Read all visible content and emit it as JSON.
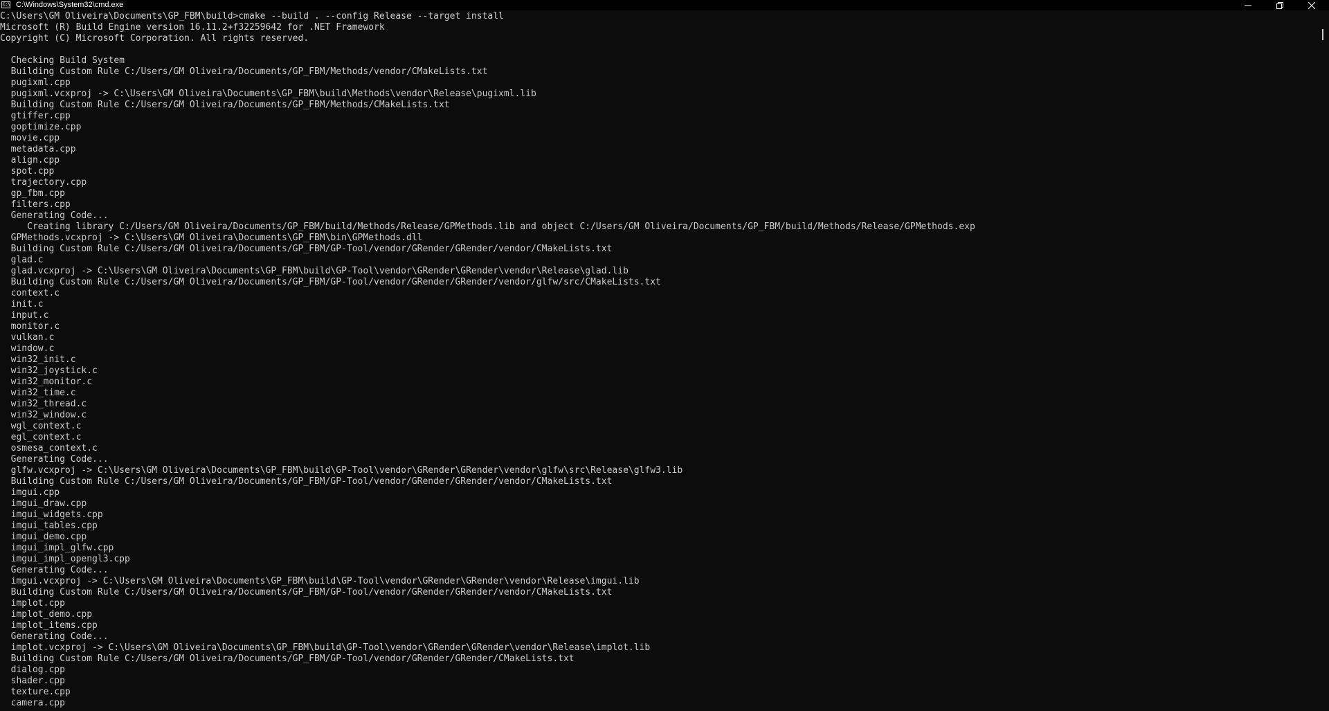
{
  "window": {
    "title": "C:\\Windows\\System32\\cmd.exe",
    "icon": "cmd-icon",
    "icon_text": "C:\\",
    "controls": {
      "minimize": "minimize-icon",
      "maximize": "restore-icon",
      "close": "close-icon"
    }
  },
  "console": {
    "lines": [
      "C:\\Users\\GM Oliveira\\Documents\\GP_FBM\\build>cmake --build . --config Release --target install",
      "Microsoft (R) Build Engine version 16.11.2+f32259642 for .NET Framework",
      "Copyright (C) Microsoft Corporation. All rights reserved.",
      "",
      "  Checking Build System",
      "  Building Custom Rule C:/Users/GM Oliveira/Documents/GP_FBM/Methods/vendor/CMakeLists.txt",
      "  pugixml.cpp",
      "  pugixml.vcxproj -> C:\\Users\\GM Oliveira\\Documents\\GP_FBM\\build\\Methods\\vendor\\Release\\pugixml.lib",
      "  Building Custom Rule C:/Users/GM Oliveira/Documents/GP_FBM/Methods/CMakeLists.txt",
      "  gtiffer.cpp",
      "  goptimize.cpp",
      "  movie.cpp",
      "  metadata.cpp",
      "  align.cpp",
      "  spot.cpp",
      "  trajectory.cpp",
      "  gp_fbm.cpp",
      "  filters.cpp",
      "  Generating Code...",
      "     Creating library C:/Users/GM Oliveira/Documents/GP_FBM/build/Methods/Release/GPMethods.lib and object C:/Users/GM Oliveira/Documents/GP_FBM/build/Methods/Release/GPMethods.exp",
      "  GPMethods.vcxproj -> C:\\Users\\GM Oliveira\\Documents\\GP_FBM\\bin\\GPMethods.dll",
      "  Building Custom Rule C:/Users/GM Oliveira/Documents/GP_FBM/GP-Tool/vendor/GRender/GRender/vendor/CMakeLists.txt",
      "  glad.c",
      "  glad.vcxproj -> C:\\Users\\GM Oliveira\\Documents\\GP_FBM\\build\\GP-Tool\\vendor\\GRender\\GRender\\vendor\\Release\\glad.lib",
      "  Building Custom Rule C:/Users/GM Oliveira/Documents/GP_FBM/GP-Tool/vendor/GRender/GRender/vendor/glfw/src/CMakeLists.txt",
      "  context.c",
      "  init.c",
      "  input.c",
      "  monitor.c",
      "  vulkan.c",
      "  window.c",
      "  win32_init.c",
      "  win32_joystick.c",
      "  win32_monitor.c",
      "  win32_time.c",
      "  win32_thread.c",
      "  win32_window.c",
      "  wgl_context.c",
      "  egl_context.c",
      "  osmesa_context.c",
      "  Generating Code...",
      "  glfw.vcxproj -> C:\\Users\\GM Oliveira\\Documents\\GP_FBM\\build\\GP-Tool\\vendor\\GRender\\GRender\\vendor\\glfw\\src\\Release\\glfw3.lib",
      "  Building Custom Rule C:/Users/GM Oliveira/Documents/GP_FBM/GP-Tool/vendor/GRender/GRender/vendor/CMakeLists.txt",
      "  imgui.cpp",
      "  imgui_draw.cpp",
      "  imgui_widgets.cpp",
      "  imgui_tables.cpp",
      "  imgui_demo.cpp",
      "  imgui_impl_glfw.cpp",
      "  imgui_impl_opengl3.cpp",
      "  Generating Code...",
      "  imgui.vcxproj -> C:\\Users\\GM Oliveira\\Documents\\GP_FBM\\build\\GP-Tool\\vendor\\GRender\\GRender\\vendor\\Release\\imgui.lib",
      "  Building Custom Rule C:/Users/GM Oliveira/Documents/GP_FBM/GP-Tool/vendor/GRender/GRender/vendor/CMakeLists.txt",
      "  implot.cpp",
      "  implot_demo.cpp",
      "  implot_items.cpp",
      "  Generating Code...",
      "  implot.vcxproj -> C:\\Users\\GM Oliveira\\Documents\\GP_FBM\\build\\GP-Tool\\vendor\\GRender\\GRender\\vendor\\Release\\implot.lib",
      "  Building Custom Rule C:/Users/GM Oliveira/Documents/GP_FBM/GP-Tool/vendor/GRender/GRender/CMakeLists.txt",
      "  dialog.cpp",
      "  shader.cpp",
      "  texture.cpp",
      "  camera.cpp"
    ]
  },
  "colors": {
    "background": "#0c0c0c",
    "foreground": "#cccccc",
    "titlebar": "#000000"
  }
}
